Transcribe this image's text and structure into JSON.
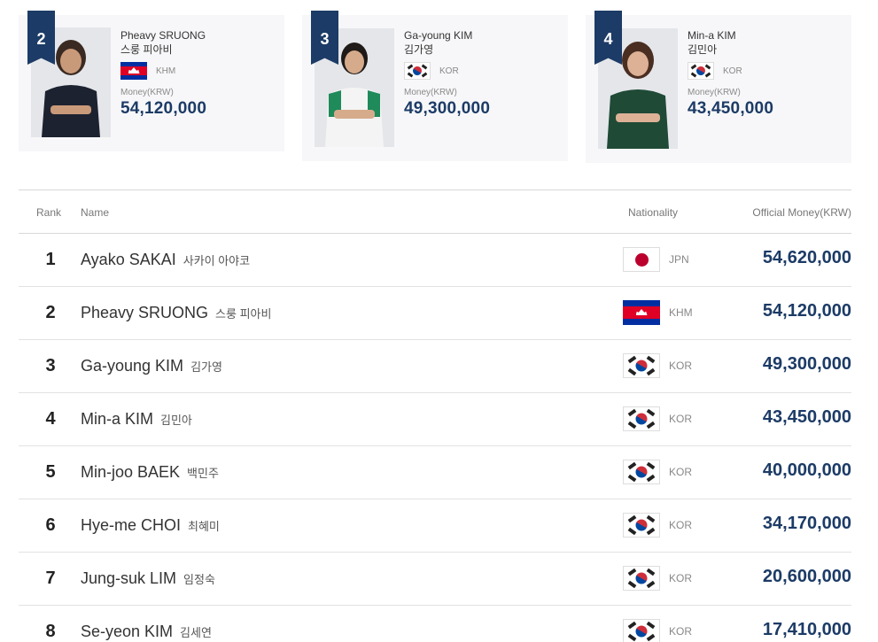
{
  "cards": [
    {
      "rank": "2",
      "name_en": "Pheavy SRUONG",
      "name_ko": "스룽 피아비",
      "nat": "KHM",
      "money_label": "Money(KRW)",
      "money": "54,120,000",
      "flag": "khm-flag"
    },
    {
      "rank": "3",
      "name_en": "Ga-young KIM",
      "name_ko": "김가영",
      "nat": "KOR",
      "money_label": "Money(KRW)",
      "money": "49,300,000",
      "flag": "kor-flag"
    },
    {
      "rank": "4",
      "name_en": "Min-a KIM",
      "name_ko": "김민아",
      "nat": "KOR",
      "money_label": "Money(KRW)",
      "money": "43,450,000",
      "flag": "kor-flag"
    }
  ],
  "table": {
    "headers": {
      "rank": "Rank",
      "name": "Name",
      "nationality": "Nationality",
      "money": "Official Money(KRW)"
    },
    "rows": [
      {
        "rank": "1",
        "name_en": "Ayako SAKAI",
        "name_ko": "사카이 아야코",
        "nat": "JPN",
        "money": "54,620,000"
      },
      {
        "rank": "2",
        "name_en": "Pheavy SRUONG",
        "name_ko": "스룽 피아비",
        "nat": "KHM",
        "money": "54,120,000"
      },
      {
        "rank": "3",
        "name_en": "Ga-young KIM",
        "name_ko": "김가영",
        "nat": "KOR",
        "money": "49,300,000"
      },
      {
        "rank": "4",
        "name_en": "Min-a KIM",
        "name_ko": "김민아",
        "nat": "KOR",
        "money": "43,450,000"
      },
      {
        "rank": "5",
        "name_en": "Min-joo BAEK",
        "name_ko": "백민주",
        "nat": "KOR",
        "money": "40,000,000"
      },
      {
        "rank": "6",
        "name_en": "Hye-me CHOI",
        "name_ko": "최혜미",
        "nat": "KOR",
        "money": "34,170,000"
      },
      {
        "rank": "7",
        "name_en": "Jung-suk LIM",
        "name_ko": "임정숙",
        "nat": "KOR",
        "money": "20,600,000"
      },
      {
        "rank": "8",
        "name_en": "Se-yeon KIM",
        "name_ko": "김세연",
        "nat": "KOR",
        "money": "17,410,000"
      }
    ]
  },
  "colors": {
    "accent_navy": "#1c3b66",
    "card_bg": "#f7f7f9",
    "jpn_red": "#bc002d",
    "kor_red": "#cd2e3a",
    "kor_blue": "#0047a0"
  }
}
